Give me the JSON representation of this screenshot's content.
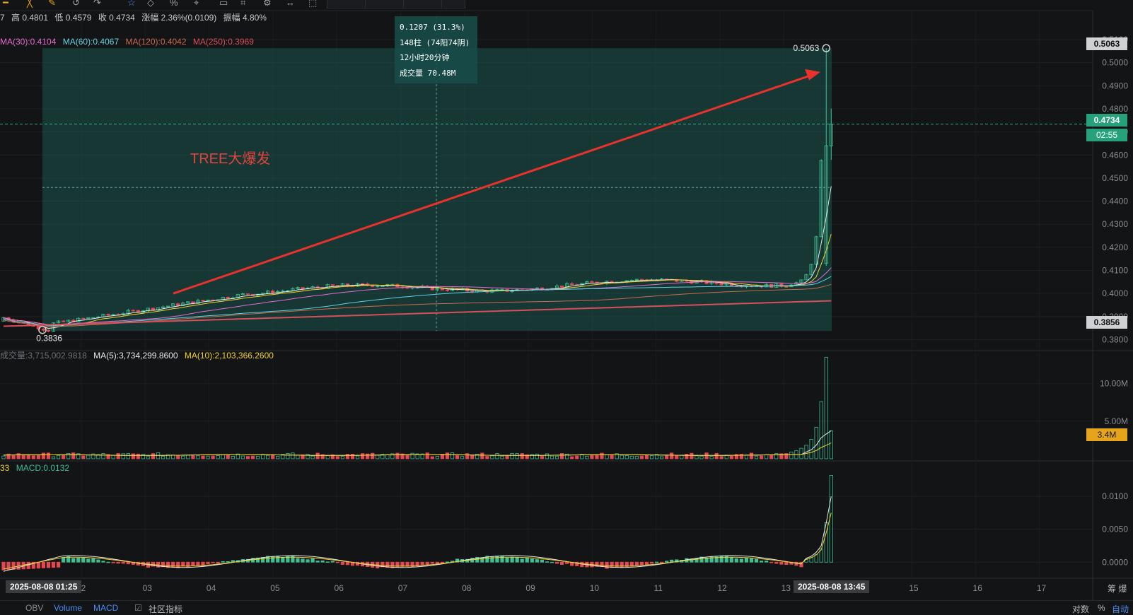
{
  "toolbar": {
    "icons": [
      "indicator-icon",
      "line-icon",
      "draw-icon",
      "undo-icon",
      "redo-icon",
      "star-icon",
      "diamond-icon",
      "percent-icon",
      "cursor-icon",
      "rect-icon",
      "camera-icon",
      "settings-icon",
      "extend-icon",
      "frame-icon"
    ]
  },
  "ohlc": {
    "prefix": "7",
    "high": "高 0.4801",
    "low": "低 0.4579",
    "close": "收 0.4734",
    "change": "涨幅 2.36%(0.0109)",
    "amplitude": "振幅 4.80%"
  },
  "ma": {
    "ma30": "MA(30):0.4104",
    "ma60": "MA(60):0.4067",
    "ma120": "MA(120):0.4042",
    "ma250": "MA(250):0.3969",
    "colors": {
      "ma30": "#e86ad0",
      "ma60": "#5fd3e6",
      "ma120": "#c96a4c",
      "ma250": "#d64f5c"
    }
  },
  "volume_legend": {
    "vol": "成交量:3,715,002.9818",
    "ma5": "MA(5):3,734,299.8600",
    "ma10": "MA(10):2,103,366.2600"
  },
  "macd_legend": {
    "prefix": "33",
    "macd": "MACD:0.0132"
  },
  "tooltip": {
    "line1": "0.1207 (31.3%)",
    "line2": "148柱 (74阳74阴)",
    "line3": "12小时20分钟",
    "line4": "成交量 70.48M"
  },
  "annotation": {
    "title": "TREE大爆发",
    "high_label": "0.5063",
    "low_label": "0.3836"
  },
  "price_tags": {
    "current": "0.4734",
    "countdown": "02:55",
    "top": "0.5063",
    "bottom": "0.3856",
    "volume": "3.4M"
  },
  "time_tags": {
    "left": "2025-08-08 01:25",
    "right": "2025-08-08 13:45"
  },
  "bottom_tabs": {
    "obv": "OBV",
    "volume": "Volume",
    "macd": "MACD",
    "community": "社区指标",
    "log": "对数",
    "percent": "%",
    "auto": "自动",
    "right_text": "筹 爆"
  },
  "colors": {
    "up": "#3dbf91",
    "down": "#e5484d",
    "accent_blue": "#4b8cf0",
    "annotation_red": "#e8322b",
    "tag_green": "#26a17b",
    "tag_orange": "#e5a41b"
  },
  "chart_data": [
    {
      "type": "candlestick",
      "title": "",
      "y_ticks": [
        "0.5100",
        "0.5000",
        "0.4900",
        "0.4800",
        "0.4700",
        "0.4600",
        "0.4500",
        "0.4400",
        "0.4300",
        "0.4200",
        "0.4100",
        "0.4000",
        "0.3900",
        "0.3800"
      ],
      "ylim": [
        0.378,
        0.514
      ],
      "x_ticks": [
        "2",
        "03",
        "04",
        "05",
        "06",
        "07",
        "08",
        "09",
        "10",
        "11",
        "12",
        "13",
        "15",
        "16",
        "17"
      ],
      "start_price": 0.3836,
      "peak_price": 0.5063,
      "last_close": 0.4734,
      "last_high": 0.4801,
      "last_low": 0.4579,
      "ma_last": {
        "ma30": 0.4104,
        "ma60": 0.4067,
        "ma120": 0.4042,
        "ma250": 0.3969
      },
      "range_box": {
        "from": 0.3856,
        "to": 0.5063,
        "change": 0.1207,
        "change_pct": 31.3,
        "bars": 148
      }
    },
    {
      "type": "bar",
      "title": "",
      "y_ticks": [
        "10.00M",
        "5.00M"
      ],
      "ylim": [
        0,
        14000000
      ],
      "last_volume": 3715002.9818,
      "ma5": 3734299.86,
      "ma10": 2103366.26,
      "peak_volume": 13500000
    },
    {
      "type": "bar",
      "title": "",
      "y_ticks": [
        "0.0100",
        "0.0050",
        "0.0000"
      ],
      "ylim": [
        -0.0018,
        0.014
      ],
      "last_macd": 0.0132
    }
  ]
}
